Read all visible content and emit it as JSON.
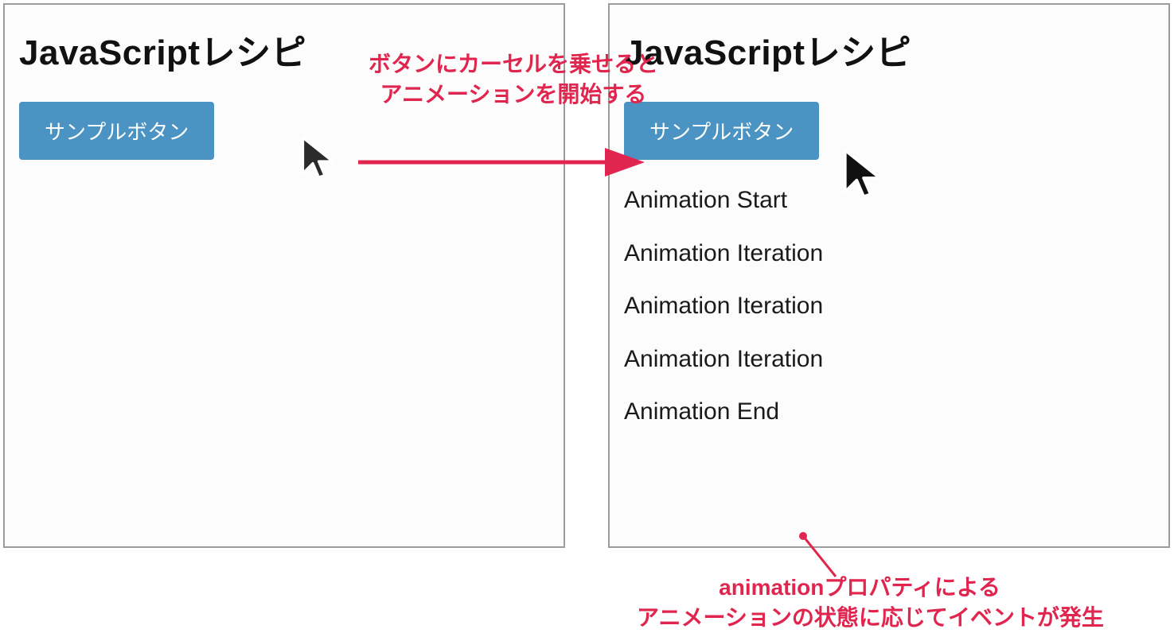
{
  "left": {
    "title": "JavaScriptレシピ",
    "button_label": "サンプルボタン"
  },
  "right": {
    "title": "JavaScriptレシピ",
    "button_label": "サンプルボタン",
    "log": [
      "Animation Start",
      "Animation Iteration",
      "Animation Iteration",
      "Animation Iteration",
      "Animation End"
    ]
  },
  "annotations": {
    "top_line1": "ボタンにカーセルを乗せると",
    "top_line2": "アニメーションを開始する",
    "bottom_line1": "animationプロパティによる",
    "bottom_line2": "アニメーションの状態に応じてイベントが発生"
  },
  "colors": {
    "accent": "#e0264f",
    "button": "#4a93c3"
  }
}
